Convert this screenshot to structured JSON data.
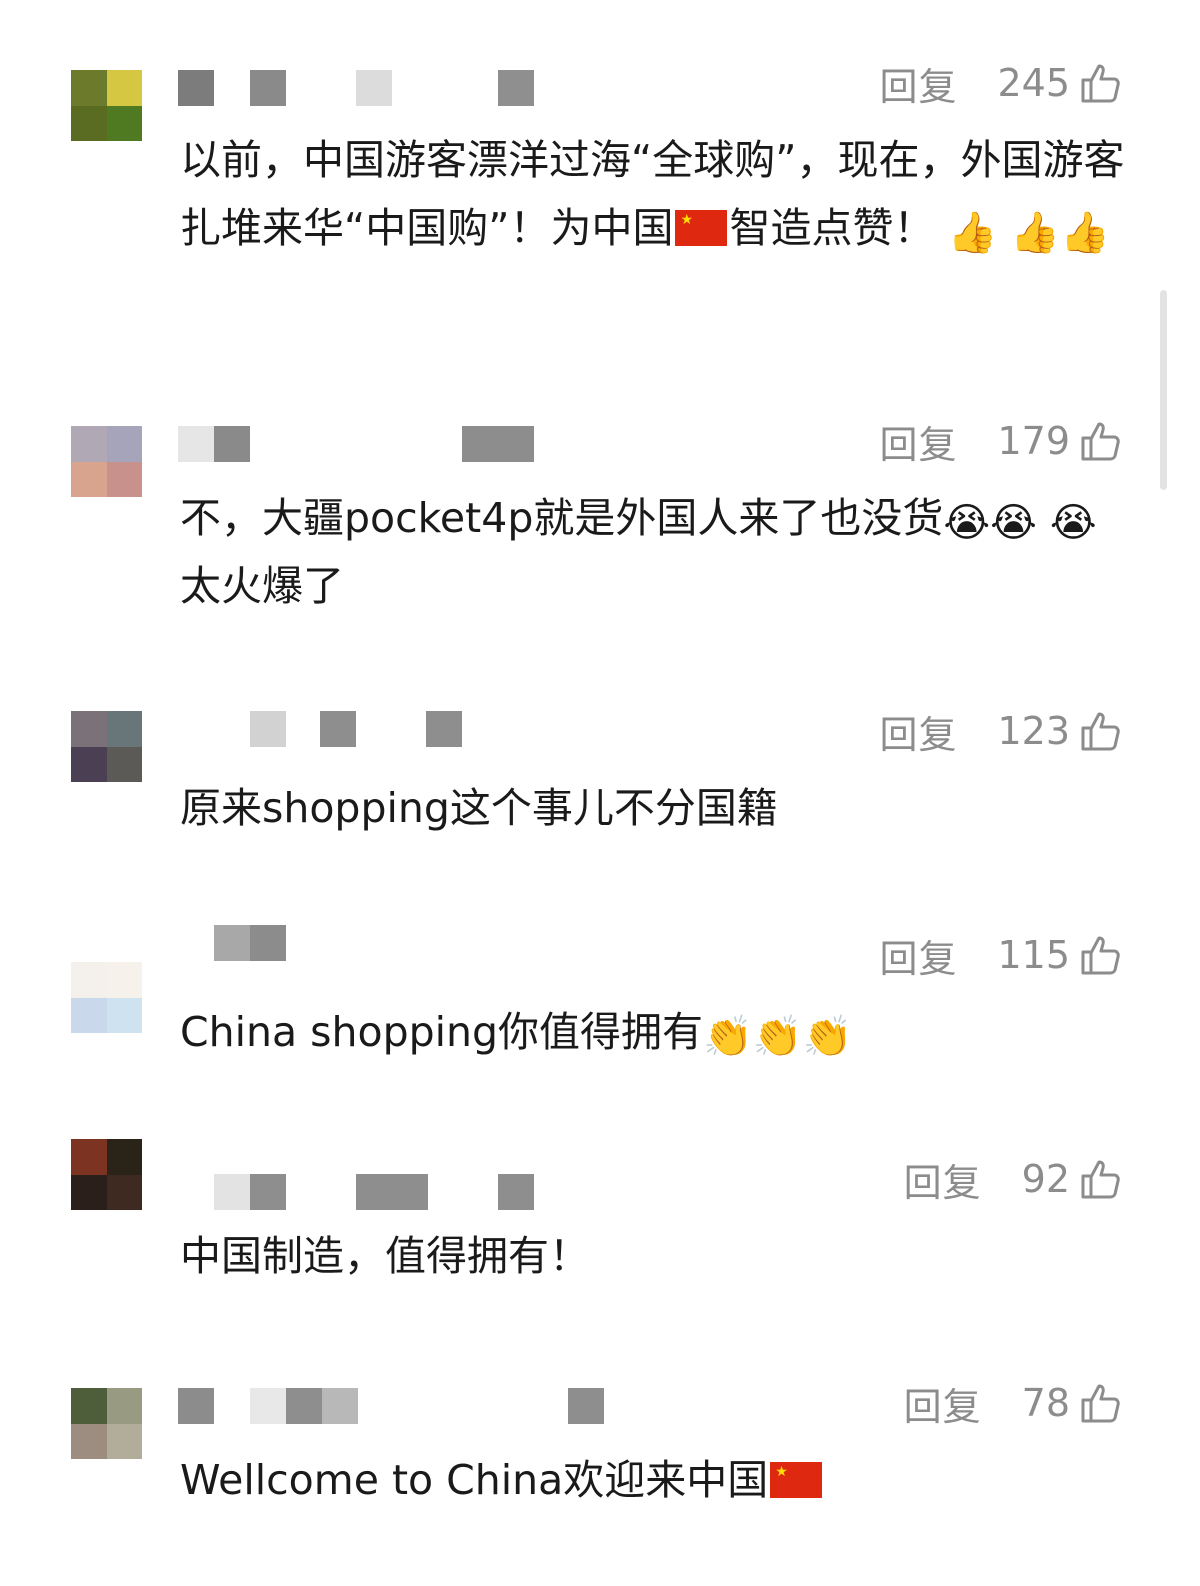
{
  "comments": [
    {
      "reply_label": "回复",
      "likes": "245",
      "text_parts": [
        "以前，中国游客漂洋过海“全球购”，现在，外国游客扎堆来华“中国购”！为中国",
        "智造点赞！"
      ],
      "emoji_after": [
        "👍",
        "👍",
        "👍"
      ],
      "avatar_colors": [
        "#6b7a2b",
        "#d6c743",
        "#5a6b22",
        "#4f7a22"
      ]
    },
    {
      "reply_label": "回复",
      "likes": "179",
      "text": "不，大疆pocket4p就是外国人来了也没货",
      "emoji_after": [
        "😭",
        "😭",
        "😭"
      ],
      "text_tail": "太火爆了",
      "avatar_colors": [
        "#b0a8b4",
        "#a5a4bb",
        "#d9a48e",
        "#c9918c"
      ]
    },
    {
      "reply_label": "回复",
      "likes": "123",
      "text": "原来shopping这个事儿不分国籍",
      "avatar_colors": [
        "#7b7279",
        "#687679",
        "#4b3f54",
        "#5b5a56"
      ]
    },
    {
      "reply_label": "回复",
      "likes": "115",
      "text": "China shopping你值得拥有",
      "emoji_after": [
        "👏",
        "👏",
        "👏"
      ],
      "avatar_colors": [
        "#f4f0ec",
        "#f6f1ea",
        "#c9d8ea",
        "#cfe2ef"
      ]
    },
    {
      "reply_label": "回复",
      "likes": "92",
      "text": "中国制造，值得拥有！",
      "avatar_colors": [
        "#7d3321",
        "#2a2418",
        "#2b1f1b",
        "#3f2a22"
      ]
    },
    {
      "reply_label": "回复",
      "likes": "78",
      "text": "Wellcome to China欢迎来中国",
      "avatar_colors": [
        "#4f5e3a",
        "#999a82",
        "#9c8d80",
        "#b2ad9a"
      ]
    }
  ]
}
